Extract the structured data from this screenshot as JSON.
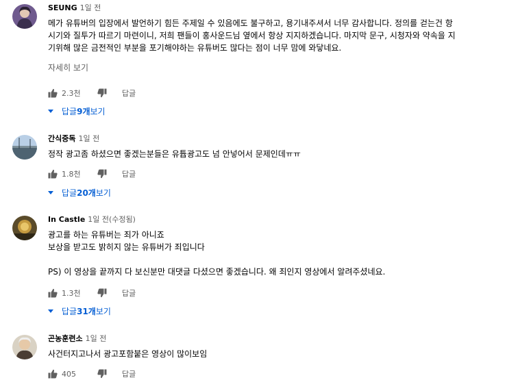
{
  "comments": [
    {
      "author": "SEUNG",
      "time": "1일 전",
      "lines": [
        "메가 유튜버의 입장에서 발언하기 힘든 주제일 수 있음에도 불구하고, 용기내주셔서 너무 감사합니다. 정의를 걷는건 항",
        "시기와 질투가 따르기 마련이니, 저희 팬들이 홍사운드님 옆에서 항상 지지하겠습니다. 마지막 문구, 시청자와 약속을 지",
        "기위해 많은 금전적인 부분을 포기해야하는 유튜버도 많다는 점이 너무 맘에 와닿네요."
      ],
      "more": "자세히 보기",
      "likes": "2.3천",
      "reply_label": "답글",
      "replies_prefix": "답글 ",
      "replies_count": "9개",
      "replies_suffix": " 보기"
    },
    {
      "author": "간식중독",
      "time": "1일 전",
      "lines": [
        "정작 광고좀 하셨으면 좋겠는분들은 유튭광고도 넘 안넣어서 문제인데ㅠㅠ"
      ],
      "likes": "1.8천",
      "reply_label": "답글",
      "replies_prefix": "답글 ",
      "replies_count": "20개",
      "replies_suffix": " 보기"
    },
    {
      "author": "In Castle",
      "time": "1일 전(수정됨)",
      "lines": [
        "광고를 하는 유튜버는 죄가 아니죠",
        "보상을 받고도 밝히지 않는 유튜버가 죄입니다",
        "",
        "PS) 이 영상을 끝까지 다 보신분만 대댓글 다셨으면 좋겠습니다. 왜 죄인지 영상에서 알려주셨네요."
      ],
      "likes": "1.3천",
      "reply_label": "답글",
      "replies_prefix": "답글 ",
      "replies_count": "31개",
      "replies_suffix": " 보기"
    },
    {
      "author": "곤농훈련소",
      "time": "1일 전",
      "lines": [
        "사건터지고나서 광고포함붙은 영상이 많이보임"
      ],
      "likes": "405",
      "reply_label": "답글"
    }
  ],
  "icons": {
    "like": "thumbs-up-icon",
    "dislike": "thumbs-down-icon",
    "expand": "triangle-down-icon"
  },
  "colors": {
    "link_blue": "#065fd4",
    "secondary_text": "#606060"
  }
}
